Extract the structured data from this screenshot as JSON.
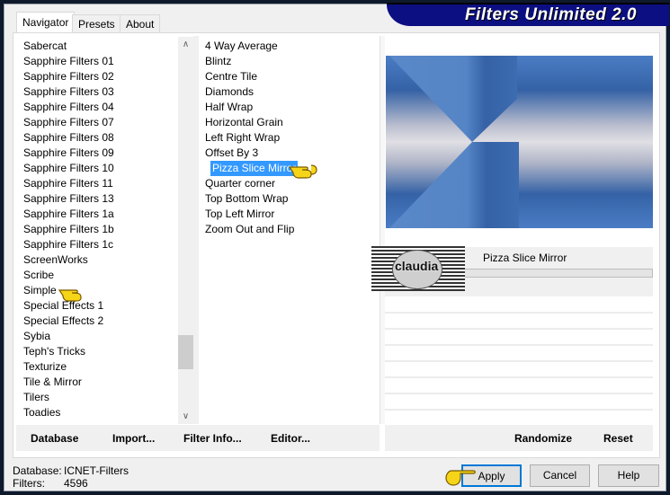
{
  "app": {
    "title": "Filters Unlimited 2.0"
  },
  "tabs": [
    {
      "label": "Navigator",
      "active": true
    },
    {
      "label": "Presets"
    },
    {
      "label": "About"
    }
  ],
  "categories": [
    "Sabercat",
    "Sapphire Filters 01",
    "Sapphire Filters 02",
    "Sapphire Filters 03",
    "Sapphire Filters 04",
    "Sapphire Filters 07",
    "Sapphire Filters 08",
    "Sapphire Filters 09",
    "Sapphire Filters 10",
    "Sapphire Filters 11",
    "Sapphire Filters 13",
    "Sapphire Filters 1a",
    "Sapphire Filters 1b",
    "Sapphire Filters 1c",
    "ScreenWorks",
    "Scribe",
    "Simple",
    "Special Effects 1",
    "Special Effects 2",
    "Sybia",
    "Teph's Tricks",
    "Texturize",
    "Tile & Mirror",
    "Tilers",
    "Toadies"
  ],
  "selected_category": "Simple",
  "filters": [
    "4 Way Average",
    "Blintz",
    "Centre Tile",
    "Diamonds",
    "Half Wrap",
    "Horizontal Grain",
    "Left Right Wrap",
    "Offset By 3",
    "Pizza Slice Mirror",
    "Quarter corner",
    "Top Bottom Wrap",
    "Top Left Mirror",
    "Zoom Out and Flip"
  ],
  "selected_filter": "Pizza Slice Mirror",
  "preview": {
    "filter_name": "Pizza Slice Mirror",
    "logo_text": "claudia",
    "colors": {
      "blue": "#3a6db3",
      "light": "#dcdce2"
    }
  },
  "left_buttons": {
    "database": "Database",
    "import": "Import...",
    "filter_info": "Filter Info...",
    "editor": "Editor..."
  },
  "right_buttons": {
    "randomize": "Randomize",
    "reset": "Reset"
  },
  "status": {
    "database_label": "Database:",
    "database_value": "ICNET-Filters",
    "filters_label": "Filters:",
    "filters_value": "4596"
  },
  "dialog_buttons": {
    "apply": "Apply",
    "cancel": "Cancel",
    "help": "Help"
  },
  "accent": "#3399ff"
}
